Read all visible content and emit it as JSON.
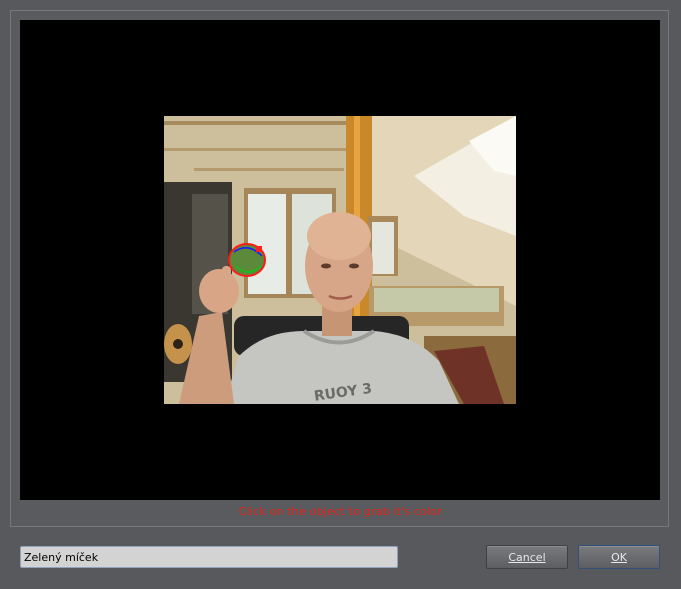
{
  "hint": "Click on the object to grab it's color",
  "object_name": {
    "value": "Zelený míček"
  },
  "buttons": {
    "cancel": "Cancel",
    "ok": "OK"
  },
  "colors": {
    "hint": "#e5241b",
    "background": "#58595c"
  }
}
